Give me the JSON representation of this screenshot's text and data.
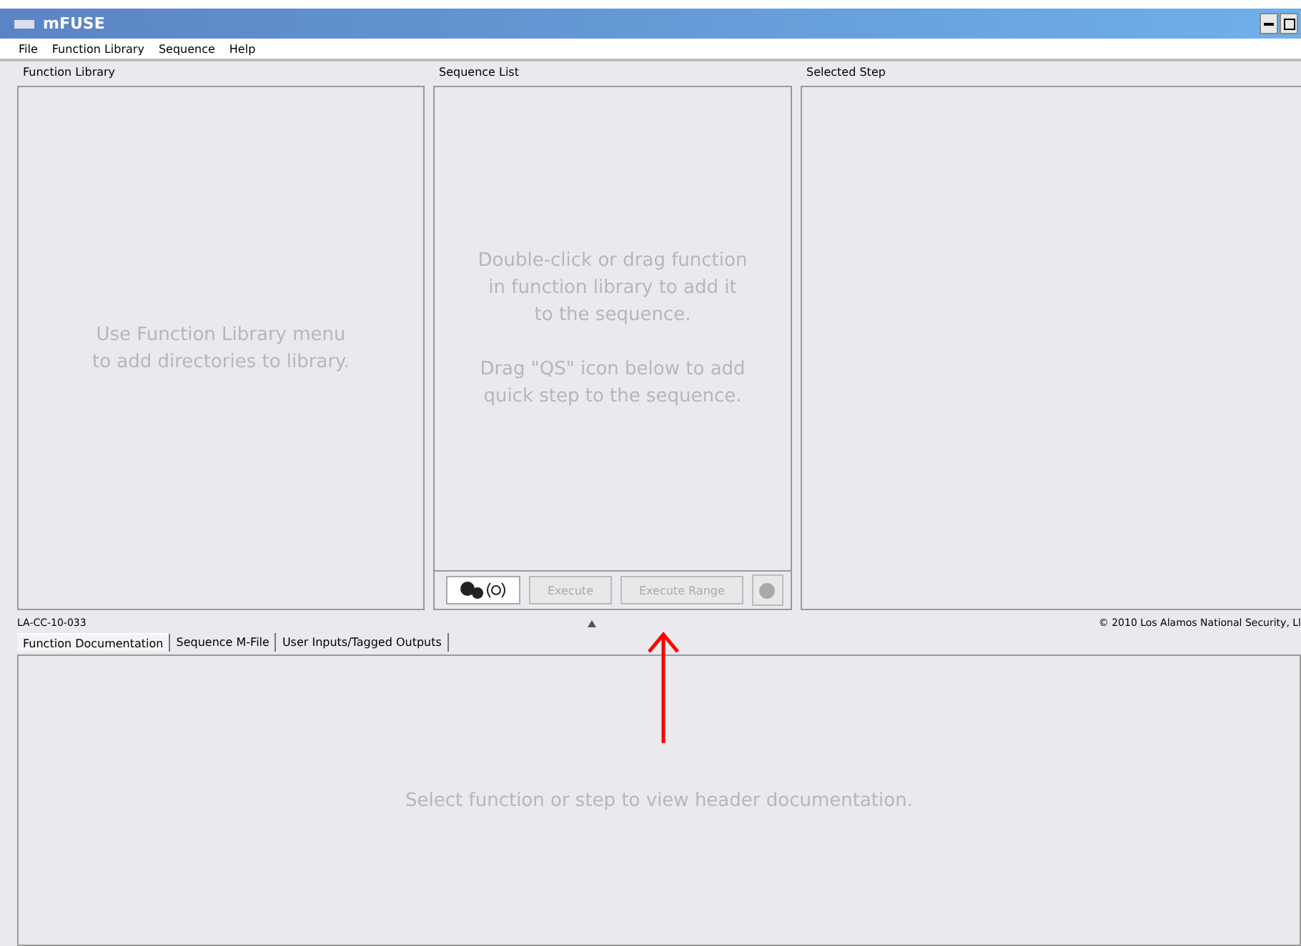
{
  "window": {
    "title": "mFUSE"
  },
  "menu": [
    "File",
    "Function Library",
    "Sequence",
    "Help"
  ],
  "panels": [
    {
      "title": "Function Library",
      "paragraphs": [
        [
          "Use Function Library menu",
          "to add directories to library."
        ]
      ]
    },
    {
      "title": "Sequence List",
      "paragraphs": [
        [
          "Double-click or drag function",
          "in function library to add it",
          "to the sequence."
        ],
        [
          "Drag \"QS\" icon below to add",
          "quick step to the sequence."
        ]
      ]
    },
    {
      "title": "Selected Step"
    }
  ],
  "sequence_toolbar": {
    "buttons": [
      {
        "label": "Execute",
        "disabled": true
      },
      {
        "label": "Execute Range",
        "disabled": true
      }
    ],
    "stop_disabled": true
  },
  "status": {
    "left": "LA-CC-10-033",
    "right": "© 2010 Los Alamos National Security, Ll"
  },
  "tabs": [
    {
      "label": "Function Documentation",
      "selected": true
    },
    {
      "label": "Sequence M-File",
      "selected": false
    },
    {
      "label": "User Inputs/Tagged Outputs",
      "selected": false
    }
  ],
  "documentation": {
    "message": "Select function or step to view header documentation."
  }
}
